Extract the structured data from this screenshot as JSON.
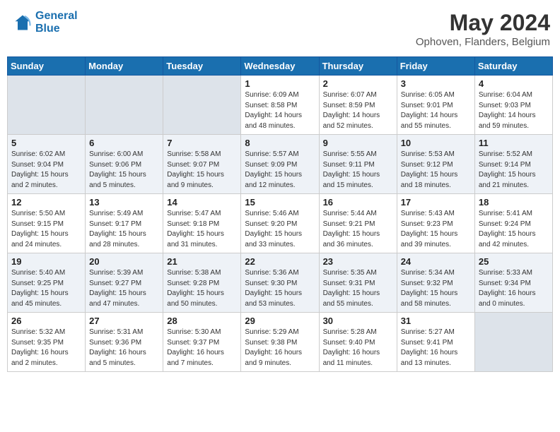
{
  "header": {
    "logo_line1": "General",
    "logo_line2": "Blue",
    "main_title": "May 2024",
    "sub_title": "Ophoven, Flanders, Belgium"
  },
  "days_of_week": [
    "Sunday",
    "Monday",
    "Tuesday",
    "Wednesday",
    "Thursday",
    "Friday",
    "Saturday"
  ],
  "weeks": [
    [
      {
        "day": "",
        "info": ""
      },
      {
        "day": "",
        "info": ""
      },
      {
        "day": "",
        "info": ""
      },
      {
        "day": "1",
        "info": "Sunrise: 6:09 AM\nSunset: 8:58 PM\nDaylight: 14 hours\nand 48 minutes."
      },
      {
        "day": "2",
        "info": "Sunrise: 6:07 AM\nSunset: 8:59 PM\nDaylight: 14 hours\nand 52 minutes."
      },
      {
        "day": "3",
        "info": "Sunrise: 6:05 AM\nSunset: 9:01 PM\nDaylight: 14 hours\nand 55 minutes."
      },
      {
        "day": "4",
        "info": "Sunrise: 6:04 AM\nSunset: 9:03 PM\nDaylight: 14 hours\nand 59 minutes."
      }
    ],
    [
      {
        "day": "5",
        "info": "Sunrise: 6:02 AM\nSunset: 9:04 PM\nDaylight: 15 hours\nand 2 minutes."
      },
      {
        "day": "6",
        "info": "Sunrise: 6:00 AM\nSunset: 9:06 PM\nDaylight: 15 hours\nand 5 minutes."
      },
      {
        "day": "7",
        "info": "Sunrise: 5:58 AM\nSunset: 9:07 PM\nDaylight: 15 hours\nand 9 minutes."
      },
      {
        "day": "8",
        "info": "Sunrise: 5:57 AM\nSunset: 9:09 PM\nDaylight: 15 hours\nand 12 minutes."
      },
      {
        "day": "9",
        "info": "Sunrise: 5:55 AM\nSunset: 9:11 PM\nDaylight: 15 hours\nand 15 minutes."
      },
      {
        "day": "10",
        "info": "Sunrise: 5:53 AM\nSunset: 9:12 PM\nDaylight: 15 hours\nand 18 minutes."
      },
      {
        "day": "11",
        "info": "Sunrise: 5:52 AM\nSunset: 9:14 PM\nDaylight: 15 hours\nand 21 minutes."
      }
    ],
    [
      {
        "day": "12",
        "info": "Sunrise: 5:50 AM\nSunset: 9:15 PM\nDaylight: 15 hours\nand 24 minutes."
      },
      {
        "day": "13",
        "info": "Sunrise: 5:49 AM\nSunset: 9:17 PM\nDaylight: 15 hours\nand 28 minutes."
      },
      {
        "day": "14",
        "info": "Sunrise: 5:47 AM\nSunset: 9:18 PM\nDaylight: 15 hours\nand 31 minutes."
      },
      {
        "day": "15",
        "info": "Sunrise: 5:46 AM\nSunset: 9:20 PM\nDaylight: 15 hours\nand 33 minutes."
      },
      {
        "day": "16",
        "info": "Sunrise: 5:44 AM\nSunset: 9:21 PM\nDaylight: 15 hours\nand 36 minutes."
      },
      {
        "day": "17",
        "info": "Sunrise: 5:43 AM\nSunset: 9:23 PM\nDaylight: 15 hours\nand 39 minutes."
      },
      {
        "day": "18",
        "info": "Sunrise: 5:41 AM\nSunset: 9:24 PM\nDaylight: 15 hours\nand 42 minutes."
      }
    ],
    [
      {
        "day": "19",
        "info": "Sunrise: 5:40 AM\nSunset: 9:25 PM\nDaylight: 15 hours\nand 45 minutes."
      },
      {
        "day": "20",
        "info": "Sunrise: 5:39 AM\nSunset: 9:27 PM\nDaylight: 15 hours\nand 47 minutes."
      },
      {
        "day": "21",
        "info": "Sunrise: 5:38 AM\nSunset: 9:28 PM\nDaylight: 15 hours\nand 50 minutes."
      },
      {
        "day": "22",
        "info": "Sunrise: 5:36 AM\nSunset: 9:30 PM\nDaylight: 15 hours\nand 53 minutes."
      },
      {
        "day": "23",
        "info": "Sunrise: 5:35 AM\nSunset: 9:31 PM\nDaylight: 15 hours\nand 55 minutes."
      },
      {
        "day": "24",
        "info": "Sunrise: 5:34 AM\nSunset: 9:32 PM\nDaylight: 15 hours\nand 58 minutes."
      },
      {
        "day": "25",
        "info": "Sunrise: 5:33 AM\nSunset: 9:34 PM\nDaylight: 16 hours\nand 0 minutes."
      }
    ],
    [
      {
        "day": "26",
        "info": "Sunrise: 5:32 AM\nSunset: 9:35 PM\nDaylight: 16 hours\nand 2 minutes."
      },
      {
        "day": "27",
        "info": "Sunrise: 5:31 AM\nSunset: 9:36 PM\nDaylight: 16 hours\nand 5 minutes."
      },
      {
        "day": "28",
        "info": "Sunrise: 5:30 AM\nSunset: 9:37 PM\nDaylight: 16 hours\nand 7 minutes."
      },
      {
        "day": "29",
        "info": "Sunrise: 5:29 AM\nSunset: 9:38 PM\nDaylight: 16 hours\nand 9 minutes."
      },
      {
        "day": "30",
        "info": "Sunrise: 5:28 AM\nSunset: 9:40 PM\nDaylight: 16 hours\nand 11 minutes."
      },
      {
        "day": "31",
        "info": "Sunrise: 5:27 AM\nSunset: 9:41 PM\nDaylight: 16 hours\nand 13 minutes."
      },
      {
        "day": "",
        "info": ""
      }
    ]
  ]
}
